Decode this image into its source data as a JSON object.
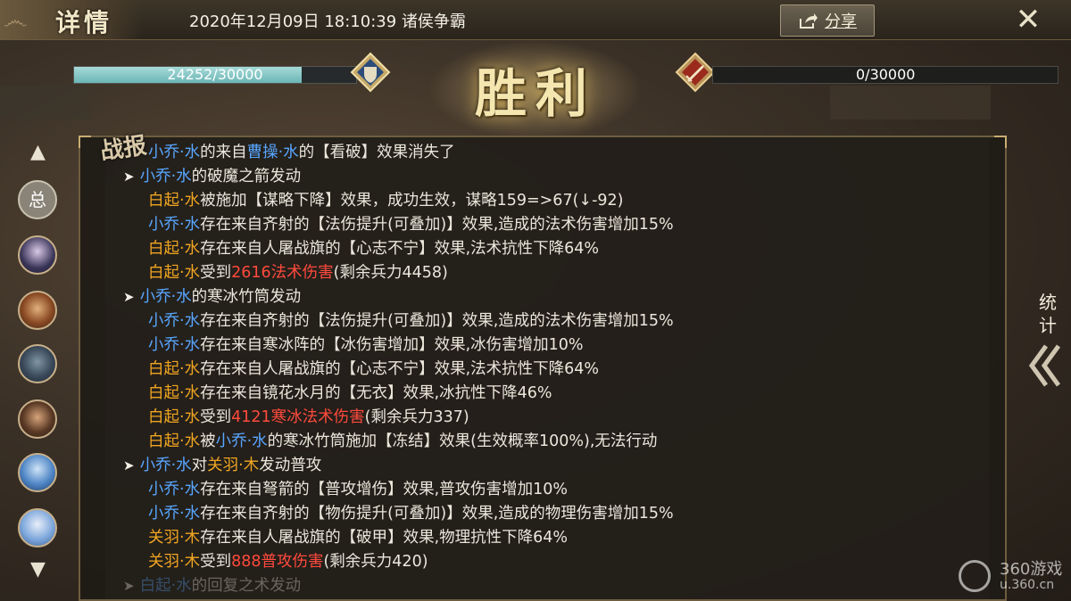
{
  "header": {
    "title": "详情",
    "datetime_mode": "2020年12月09日 18:10:39 诸侯争霸",
    "share_label": "分享",
    "share_icon": "share-icon",
    "close_icon": "close-icon"
  },
  "result_banner": "胜利",
  "player_bar": {
    "text": "24252/30000",
    "fraction": 0.8084
  },
  "enemy_bar": {
    "text": "0/30000",
    "fraction": 0.0
  },
  "report_label": "战报",
  "nav": {
    "up_icon": "chevron-up-icon",
    "total_label": "总",
    "down_icon": "chevron-down-icon"
  },
  "stats": {
    "label_1": "统",
    "label_2": "计"
  },
  "watermark": {
    "brand": "360游戏",
    "url": "u.360.cn"
  },
  "colors": {
    "ally": "#58a6ff",
    "enemy": "#f0a522",
    "damage": "#ff4a3d"
  },
  "battle_log": [
    {
      "type": "sub",
      "segs": [
        {
          "t": "小乔·水",
          "c": "b"
        },
        {
          "t": "的来自"
        },
        {
          "t": "曹操·水",
          "c": "b"
        },
        {
          "t": "的【看破】效果消失了"
        }
      ]
    },
    {
      "type": "head",
      "segs": [
        {
          "t": "小乔·水",
          "c": "b"
        },
        {
          "t": "的破魔之箭发动"
        }
      ]
    },
    {
      "type": "sub",
      "segs": [
        {
          "t": "白起·水",
          "c": "o"
        },
        {
          "t": "被施加【谋略下降】效果，成功生效，谋略159=>67(↓-92)"
        }
      ]
    },
    {
      "type": "sub",
      "segs": [
        {
          "t": "小乔·水",
          "c": "b"
        },
        {
          "t": "存在来自齐射的【法伤提升(可叠加)】效果,造成的法术伤害增加15%"
        }
      ]
    },
    {
      "type": "sub",
      "segs": [
        {
          "t": "白起·水",
          "c": "o"
        },
        {
          "t": "存在来自人屠战旗的【心志不宁】效果,法术抗性下降64%"
        }
      ]
    },
    {
      "type": "sub",
      "segs": [
        {
          "t": "白起·水",
          "c": "o"
        },
        {
          "t": "受到"
        },
        {
          "t": "2616法术伤害",
          "c": "r"
        },
        {
          "t": "(剩余兵力4458)"
        }
      ]
    },
    {
      "type": "head",
      "segs": [
        {
          "t": "小乔·水",
          "c": "b"
        },
        {
          "t": "的寒冰竹筒发动"
        }
      ]
    },
    {
      "type": "sub",
      "segs": [
        {
          "t": "小乔·水",
          "c": "b"
        },
        {
          "t": "存在来自齐射的【法伤提升(可叠加)】效果,造成的法术伤害增加15%"
        }
      ]
    },
    {
      "type": "sub",
      "segs": [
        {
          "t": "小乔·水",
          "c": "b"
        },
        {
          "t": "存在来自寒冰阵的【冰伤害增加】效果,冰伤害增加10%"
        }
      ]
    },
    {
      "type": "sub",
      "segs": [
        {
          "t": "白起·水",
          "c": "o"
        },
        {
          "t": "存在来自人屠战旗的【心志不宁】效果,法术抗性下降64%"
        }
      ]
    },
    {
      "type": "sub",
      "segs": [
        {
          "t": "白起·水",
          "c": "o"
        },
        {
          "t": "存在来自镜花水月的【无衣】效果,冰抗性下降46%"
        }
      ]
    },
    {
      "type": "sub",
      "segs": [
        {
          "t": "白起·水",
          "c": "o"
        },
        {
          "t": "受到"
        },
        {
          "t": "4121寒冰法术伤害",
          "c": "r"
        },
        {
          "t": "(剩余兵力337)"
        }
      ]
    },
    {
      "type": "sub",
      "segs": [
        {
          "t": "白起·水",
          "c": "o"
        },
        {
          "t": "被"
        },
        {
          "t": "小乔·水",
          "c": "b"
        },
        {
          "t": "的寒冰竹筒施加【冻结】效果(生效概率100%),无法行动"
        }
      ]
    },
    {
      "type": "head",
      "segs": [
        {
          "t": "小乔·水",
          "c": "b"
        },
        {
          "t": "对"
        },
        {
          "t": "关羽·木",
          "c": "o"
        },
        {
          "t": "发动普攻"
        }
      ]
    },
    {
      "type": "sub",
      "segs": [
        {
          "t": "小乔·水",
          "c": "b"
        },
        {
          "t": "存在来自弩箭的【普攻增伤】效果,普攻伤害增加10%"
        }
      ]
    },
    {
      "type": "sub",
      "segs": [
        {
          "t": "小乔·水",
          "c": "b"
        },
        {
          "t": "存在来自齐射的【物伤提升(可叠加)】效果,造成的物理伤害增加15%"
        }
      ]
    },
    {
      "type": "sub",
      "segs": [
        {
          "t": "关羽·木",
          "c": "o"
        },
        {
          "t": "存在来自人屠战旗的【破甲】效果,物理抗性下降64%"
        }
      ]
    },
    {
      "type": "sub",
      "segs": [
        {
          "t": "关羽·木",
          "c": "o"
        },
        {
          "t": "受到"
        },
        {
          "t": "888普攻伤害",
          "c": "r"
        },
        {
          "t": "(剩余兵力420)"
        }
      ]
    },
    {
      "type": "head fade",
      "segs": [
        {
          "t": "白起·水",
          "c": "b"
        },
        {
          "t": "的回复之术发动"
        }
      ]
    }
  ]
}
